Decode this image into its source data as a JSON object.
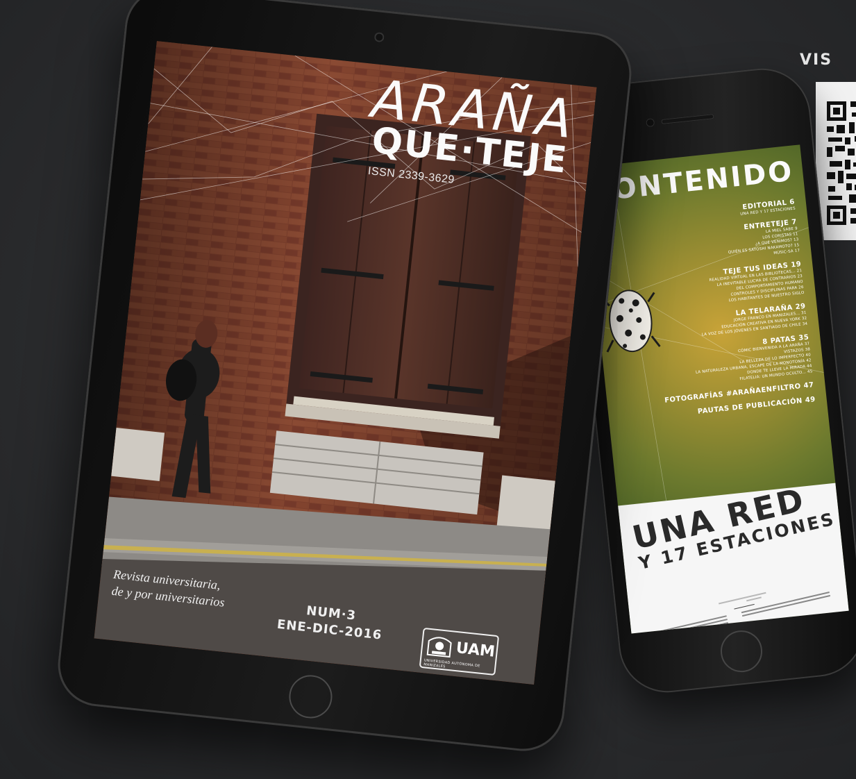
{
  "promo": {
    "visit_label": "VIS"
  },
  "tablet": {
    "cover": {
      "title_line_1": "ARAÑA",
      "title_line_2": "QUE·TEJE",
      "issn": "ISSN 2339-3629",
      "tagline_line_1": "Revista universitaria,",
      "tagline_line_2": "de y por universitarios",
      "issue_number": "NUM·3",
      "issue_dates": "ENE-DIC-2016",
      "publisher_logo": "UAM",
      "publisher_subtitle": "UNIVERSIDAD AUTÓNOMA DE MANIZALES"
    }
  },
  "phone": {
    "toc_title": "CONTENIDO",
    "toc_sections": [
      {
        "heading": "EDITORIAL  6",
        "items": [
          "UNA RED Y 17 ESTACIONES"
        ]
      },
      {
        "heading": "ENTRETEJE  7",
        "items": [
          "LA MIEL SABE  9",
          "LOS CORISTAS  11",
          "¿A QUÉ VENIMOS?  13",
          "QUIÉN ES SATOSHI NAKAMOTO?  15",
          "MÚSIC-SA  17"
        ]
      },
      {
        "heading": "TEJE TUS IDEAS  19",
        "items": [
          "REALIDAD VIRTUAL EN LAS BIBLIOTECAS...  21",
          "LA INEVITABLE LUCHA DE CONTRARIOS  23",
          "DEL COMPORTAMIENTO HUMANO",
          "CONTROLES Y DISCIPLINAS PARA  26",
          "LOS HABITANTES DE NUESTRO SIGLO"
        ]
      },
      {
        "heading": "LA TELARAÑA  29",
        "items": [
          "JORGE FRANCO EN MANIZALES...  31",
          "EDUCACIÓN CREATIVA EN NUEVA YORK  32",
          "LA VOZ DE LOS JÓVENES EN SANTIAGO DE CHILE  34"
        ]
      },
      {
        "heading": "8 PATAS  35",
        "items": [
          "CÓMIC BIENVENIDA A LA ARAÑA  37",
          "VISTAZOS  38",
          "LA BELLEZA DE LO IMPERFECTO  40",
          "LA NATURALEZA URBANA, ESCAPE DE LA MONOTONÍA  42",
          "DONDE TE LLEVE LA MIRADA  44",
          "FILATELIA: UN MUNDO OCULTO...  45"
        ]
      },
      {
        "heading": "FOTOGRAFÍAS #ARAÑAENFILTRO  47",
        "items": []
      },
      {
        "heading": "PAUTAS DE PUBLICACIÓN  49",
        "items": []
      }
    ],
    "article_title_line_1": "UNA RED",
    "article_title_line_2": "Y 17 ESTACIONES"
  },
  "colors": {
    "background": "#2b2c2e",
    "brick": "#7a3f2b",
    "door": "#4b2b22",
    "phone_screen": "#7a8a2e",
    "panel": "#f6f6f6"
  }
}
